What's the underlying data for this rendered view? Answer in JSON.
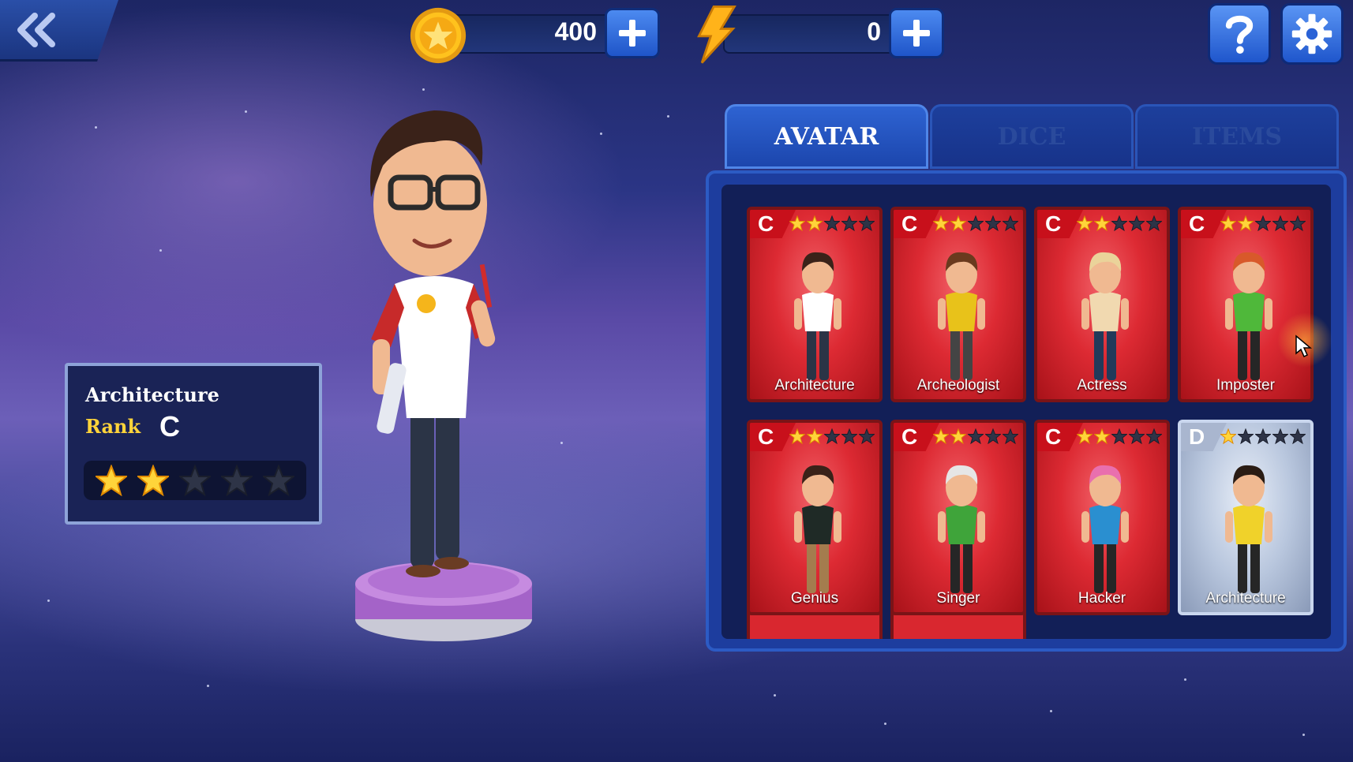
{
  "currency": {
    "coins": "400",
    "energy": "0"
  },
  "selected": {
    "name": "Architecture",
    "rank_label": "Rank",
    "rank": "C",
    "stars": 2,
    "max_stars": 5
  },
  "tabs": [
    {
      "label": "AVATAR",
      "active": true
    },
    {
      "label": "DICE",
      "active": false
    },
    {
      "label": "ITEMS",
      "active": false
    }
  ],
  "avatars": [
    {
      "name": "Architecture",
      "rank": "C",
      "stars": 2
    },
    {
      "name": "Archeologist",
      "rank": "C",
      "stars": 2
    },
    {
      "name": "Actress",
      "rank": "C",
      "stars": 2
    },
    {
      "name": "Imposter",
      "rank": "C",
      "stars": 2
    },
    {
      "name": "Genius",
      "rank": "C",
      "stars": 2
    },
    {
      "name": "Singer",
      "rank": "C",
      "stars": 2
    },
    {
      "name": "Hacker",
      "rank": "C",
      "stars": 2
    },
    {
      "name": "Architecture",
      "rank": "D",
      "stars": 1
    }
  ],
  "icons": [
    "back-arrows-icon",
    "coin-icon",
    "lightning-icon",
    "plus-icon",
    "help-icon",
    "gear-icon",
    "star-icon",
    "cursor-icon"
  ],
  "colors": {
    "accent_blue": "#2e63d2",
    "card_red": "#dd2a33",
    "card_grey": "#b9c7de",
    "star_gold": "#ffd43a",
    "rank_label": "#ffd43a"
  }
}
